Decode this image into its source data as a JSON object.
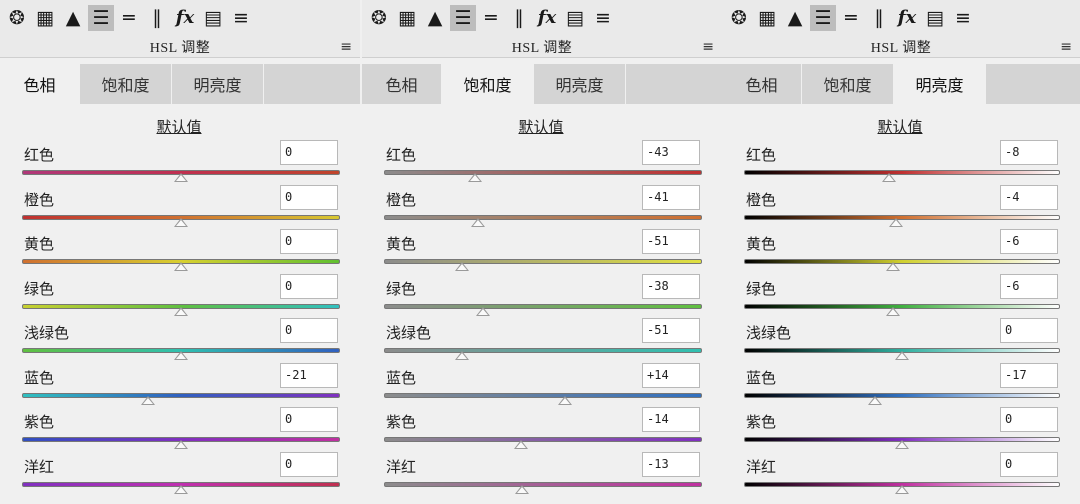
{
  "toolbar_icons": [
    "aperture-icon",
    "grid-icon",
    "mountain-icon",
    "hsl-curves-icon",
    "split-toning-icon",
    "lens-icon",
    "fx-icon",
    "camera-calibration-icon",
    "presets-sliders-icon"
  ],
  "fx_label": "fx",
  "panel_title": "HSL 调整",
  "defaults_label": "默认值",
  "tabs": [
    "色相",
    "饱和度",
    "明亮度"
  ],
  "colors": {
    "hue_gradients": [
      "linear-gradient(90deg,#b0387a,#c03050,#c0442a)",
      "linear-gradient(90deg,#c03030,#d07030,#d8c830)",
      "linear-gradient(90deg,#d07030,#d8d030,#60c030)",
      "linear-gradient(90deg,#c8d030,#60c040,#30c0c0)",
      "linear-gradient(90deg,#60c040,#30c0b0,#3060c0)",
      "linear-gradient(90deg,#30c0c0,#3060c0,#8030c0)",
      "linear-gradient(90deg,#3050c0,#8030c0,#c030a0)",
      "linear-gradient(90deg,#8030c0,#c030b0,#c03050)"
    ],
    "sat_gradients": [
      "linear-gradient(90deg,#8c8c8c,#c03030)",
      "linear-gradient(90deg,#8c8c8c,#d07030)",
      "linear-gradient(90deg,#8c8c8c,#e0e040)",
      "linear-gradient(90deg,#8c8c8c,#60c040)",
      "linear-gradient(90deg,#8c8c8c,#30c0b0)",
      "linear-gradient(90deg,#8c8c8c,#3070c0)",
      "linear-gradient(90deg,#8c8c8c,#8030c0)",
      "linear-gradient(90deg,#8c8c8c,#c030a0)"
    ],
    "lum_gradients": [
      "linear-gradient(90deg,#000,#c03030,#fff)",
      "linear-gradient(90deg,#000,#d07030,#fff)",
      "linear-gradient(90deg,#000,#d0d030,#fff)",
      "linear-gradient(90deg,#000,#40b040,#fff)",
      "linear-gradient(90deg,#000,#30b0a0,#fff)",
      "linear-gradient(90deg,#000,#3070c0,#fff)",
      "linear-gradient(90deg,#000,#8030c0,#fff)",
      "linear-gradient(90deg,#000,#c030a0,#fff)"
    ]
  },
  "panels": [
    {
      "active_tab": 0,
      "rows": [
        {
          "label": "红色",
          "value": "0",
          "level": 0
        },
        {
          "label": "橙色",
          "value": "0",
          "level": 0
        },
        {
          "label": "黄色",
          "value": "0",
          "level": 0
        },
        {
          "label": "绿色",
          "value": "0",
          "level": 0
        },
        {
          "label": "浅绿色",
          "value": "0",
          "level": 0
        },
        {
          "label": "蓝色",
          "value": "-21",
          "level": -21
        },
        {
          "label": "紫色",
          "value": "0",
          "level": 0
        },
        {
          "label": "洋红",
          "value": "0",
          "level": 0
        }
      ]
    },
    {
      "active_tab": 1,
      "rows": [
        {
          "label": "红色",
          "value": "-43",
          "level": -43
        },
        {
          "label": "橙色",
          "value": "-41",
          "level": -41
        },
        {
          "label": "黄色",
          "value": "-51",
          "level": -51
        },
        {
          "label": "绿色",
          "value": "-38",
          "level": -38
        },
        {
          "label": "浅绿色",
          "value": "-51",
          "level": -51
        },
        {
          "label": "蓝色",
          "value": "+14",
          "level": 14
        },
        {
          "label": "紫色",
          "value": "-14",
          "level": -14
        },
        {
          "label": "洋红",
          "value": "-13",
          "level": -13
        }
      ]
    },
    {
      "active_tab": 2,
      "rows": [
        {
          "label": "红色",
          "value": "-8",
          "level": -8
        },
        {
          "label": "橙色",
          "value": "-4",
          "level": -4
        },
        {
          "label": "黄色",
          "value": "-6",
          "level": -6
        },
        {
          "label": "绿色",
          "value": "-6",
          "level": -6
        },
        {
          "label": "浅绿色",
          "value": "0",
          "level": 0
        },
        {
          "label": "蓝色",
          "value": "-17",
          "level": -17
        },
        {
          "label": "紫色",
          "value": "0",
          "level": 0
        },
        {
          "label": "洋红",
          "value": "0",
          "level": 0
        }
      ]
    }
  ]
}
